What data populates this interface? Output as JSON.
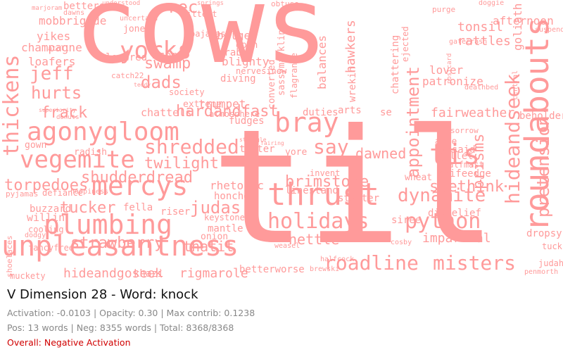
{
  "title": "V Dimension 28 - Word: knock",
  "stats": {
    "activation_line": "Activation: -0.0103 | Opacity: 0.30 | Max contrib: 0.1238",
    "counts_line": "Pos: 13 words | Neg: 8355 words | Total: 8368/8368",
    "overall": "Overall: Negative Activation"
  },
  "colors": {
    "cloud_word": "#ff9a9a",
    "overall_text": "#d00000",
    "stats_text": "#888888"
  },
  "words": [
    "cows",
    "til",
    "unpleasantness",
    "agonygloom",
    "plumbing",
    "vegemite",
    "thrust",
    "mercys",
    "roundabouts",
    "hideandseek",
    "roadline",
    "misters",
    "python",
    "thickens",
    "bray",
    "yorks",
    "tis",
    "shredded",
    "holidays",
    "appointment",
    "pretension",
    "dynamite",
    "hardandfast",
    "jeff",
    "hurts",
    "say",
    "strawberry",
    "swamp",
    "dads",
    "twilight",
    "shudderdread",
    "torpedoes",
    "brimstone",
    "seethink",
    "prisms",
    "judas",
    "tucker",
    "rec",
    "frack",
    "dawned",
    "fairweather",
    "hideandgoseek",
    "rigmarole",
    "thatit",
    "nettle",
    "impartial",
    "betterworse",
    "lover",
    "patronize",
    "afternoon",
    "goliath",
    "beholder",
    "tonsil",
    "rattles",
    "hawkers",
    "balances",
    "mobbrigade",
    "champagne",
    "loafers",
    "yikes",
    "betters",
    "extreme",
    "chattels",
    "gown",
    "radish",
    "willin",
    "buzzard",
    "cooling",
    "fancyfree",
    "muckety",
    "khazi",
    "onion",
    "mantle",
    "rhetoric",
    "honcho",
    "keystone",
    "riser",
    "fella",
    "disbelief",
    "siree",
    "dropsy",
    "tuck",
    "judah",
    "penmorth",
    "gullet",
    "asbe",
    "unsaid",
    "knifeedge",
    "wheat",
    "linestand",
    "stutter",
    "invent",
    "yore",
    "duties",
    "arts",
    "se",
    "bilge",
    "crab",
    "blighty",
    "diving",
    "lowered",
    "asome",
    "jones",
    "fittest",
    "pajamas",
    "doin",
    "nervesinew",
    "wrekin",
    "flagrante",
    "sassymarkline",
    "converted",
    "ejected",
    "chattering",
    "society",
    "trumpet",
    "fudges",
    "atmosphere",
    "titter",
    "fairing",
    "strangle",
    "defiance",
    "happiness",
    "pyjamas",
    "shoelaces",
    "dodgy",
    "weasel",
    "halfcock",
    "brewski",
    "cosby",
    "halfmast",
    "sorrow",
    "deathbed",
    "central",
    "suspenders",
    "doggie",
    "purge",
    "obtuse",
    "understood",
    "springs",
    "marjoram",
    "dawns",
    "uncertain",
    "gatecrash",
    "postcard",
    "atoll",
    "catch22",
    "teddy",
    "donuts",
    "superiority",
    "sherlock"
  ]
}
